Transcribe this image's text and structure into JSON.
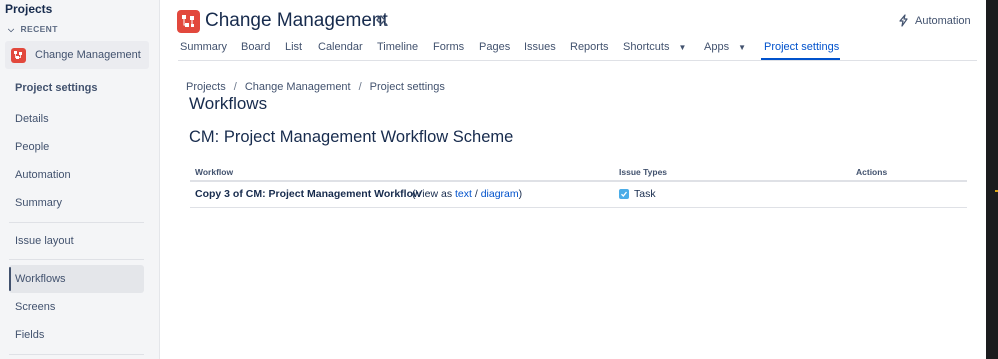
{
  "sidebar": {
    "title": "Projects",
    "recent_label": "RECENT",
    "project_name": "Change Management",
    "section_title": "Project settings",
    "items": [
      {
        "label": "Details"
      },
      {
        "label": "People"
      },
      {
        "label": "Automation"
      },
      {
        "label": "Summary"
      },
      {
        "label": "Issue layout"
      },
      {
        "label": "Workflows",
        "active": true
      },
      {
        "label": "Screens"
      },
      {
        "label": "Fields"
      }
    ]
  },
  "header": {
    "project_title": "Change Management",
    "automation_label": "Automation",
    "tabs": [
      {
        "label": "Summary"
      },
      {
        "label": "Board"
      },
      {
        "label": "List"
      },
      {
        "label": "Calendar"
      },
      {
        "label": "Timeline"
      },
      {
        "label": "Forms"
      },
      {
        "label": "Pages"
      },
      {
        "label": "Issues"
      },
      {
        "label": "Reports"
      },
      {
        "label": "Shortcuts"
      },
      {
        "label": "Apps"
      },
      {
        "label": "Project settings",
        "active": true
      }
    ]
  },
  "breadcrumb": [
    "Projects",
    "Change Management",
    "Project settings"
  ],
  "breadcrumb_sep": "/",
  "page_title": "Workflows",
  "scheme_title": "CM: Project Management Workflow Scheme",
  "table": {
    "headers": {
      "workflow": "Workflow",
      "issue_types": "Issue Types",
      "actions": "Actions"
    },
    "rows": [
      {
        "workflow": "Copy 3 of CM: Project Management Workflow",
        "view_prefix": "(View as",
        "view_text_link": "text",
        "view_sep": "/",
        "view_diagram_link": "diagram",
        "view_suffix": ")",
        "issue_type": "Task"
      }
    ]
  },
  "colors": {
    "project_icon": "#e2483d",
    "accent": "#0052cc",
    "task_icon": "#4bade8"
  }
}
